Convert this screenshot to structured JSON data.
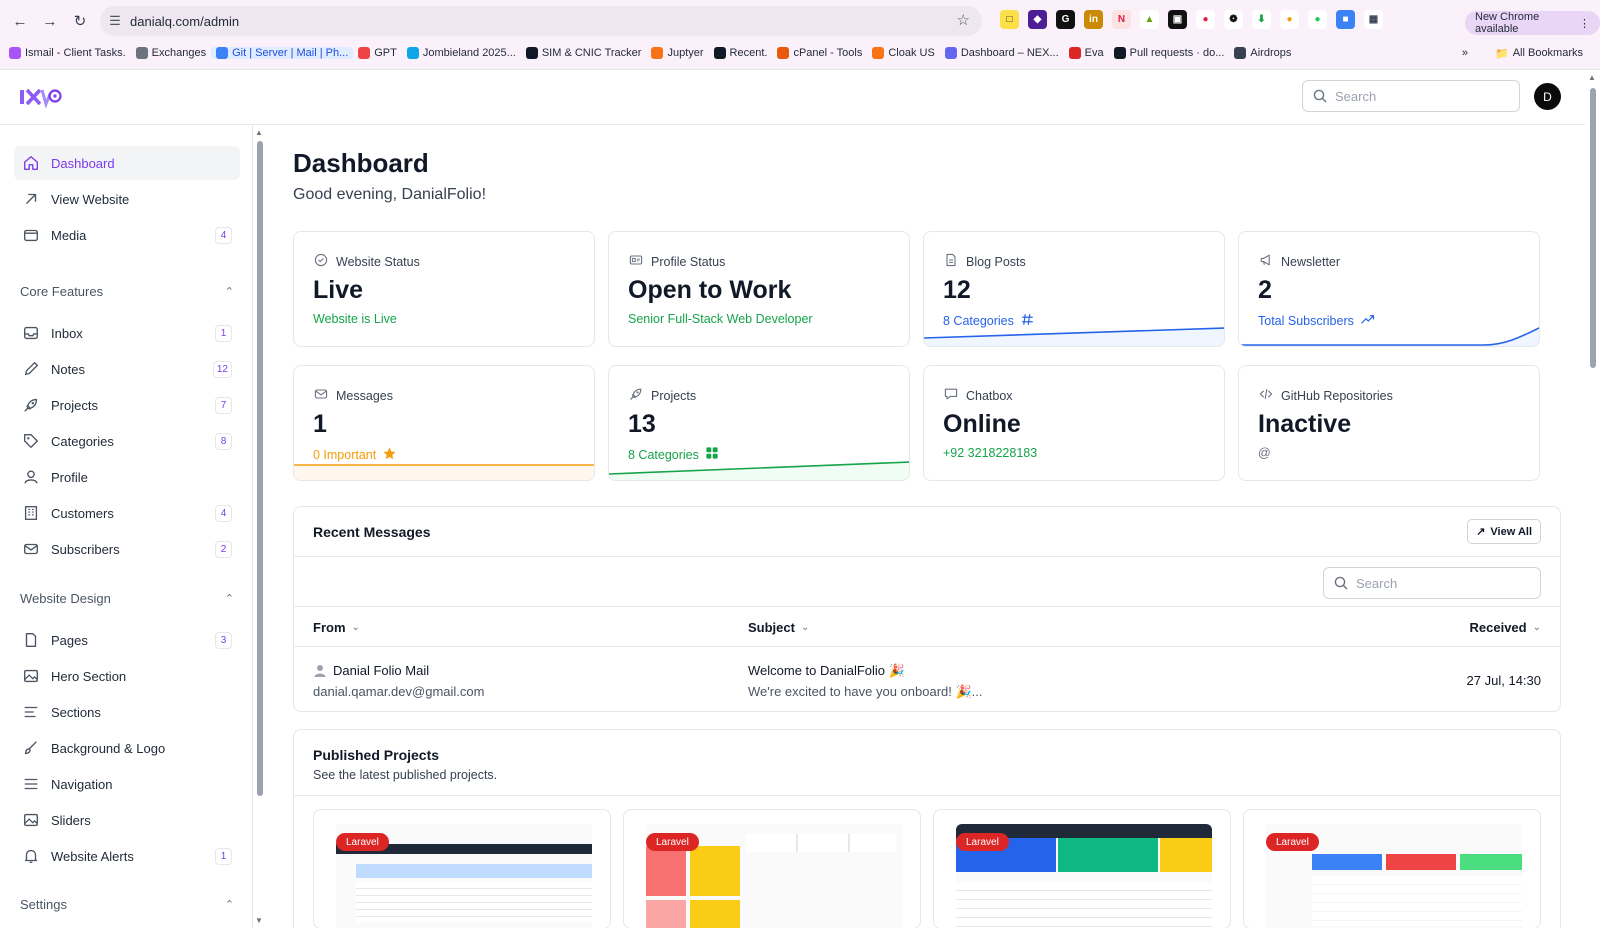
{
  "browser": {
    "url": "danialq.com/admin",
    "update_label": "New Chrome available",
    "bookmarks": [
      {
        "label": "Ismail - Client Tasks.",
        "color": "#a855f7"
      },
      {
        "label": "Exchanges",
        "color": "#6b7280"
      },
      {
        "label": "Git | Server | Mail | Ph...",
        "color": "#3b82f6"
      },
      {
        "label": "GPT",
        "color": "#ef4444"
      },
      {
        "label": "Jombieland 2025...",
        "color": "#0ea5e9"
      },
      {
        "label": "SIM & CNIC Tracker",
        "color": "#111827"
      },
      {
        "label": "Juptyer",
        "color": "#f97316"
      },
      {
        "label": "Recent.",
        "color": "#111827"
      },
      {
        "label": "cPanel - Tools",
        "color": "#ea580c"
      },
      {
        "label": "Cloak US",
        "color": "#f97316"
      },
      {
        "label": "Dashboard – NEX...",
        "color": "#6366f1"
      },
      {
        "label": "Eva",
        "color": "#dc2626"
      },
      {
        "label": "Pull requests · do...",
        "color": "#111827"
      },
      {
        "label": "Airdrops",
        "color": "#374151"
      }
    ],
    "all_bookmarks_label": "All Bookmarks"
  },
  "header": {
    "search_placeholder": "Search",
    "avatar_initial": "D"
  },
  "sidebar": {
    "top_items": [
      {
        "label": "Dashboard",
        "icon": "home-icon",
        "active": true
      },
      {
        "label": "View Website",
        "icon": "arrow-up-right-icon"
      },
      {
        "label": "Media",
        "icon": "folder-icon",
        "badge": "4"
      }
    ],
    "core_features": {
      "title": "Core Features",
      "items": [
        {
          "label": "Inbox",
          "icon": "inbox-icon",
          "badge": "1"
        },
        {
          "label": "Notes",
          "icon": "pencil-icon",
          "badge": "12"
        },
        {
          "label": "Projects",
          "icon": "rocket-icon",
          "badge": "7"
        },
        {
          "label": "Categories",
          "icon": "tag-icon",
          "badge": "8"
        },
        {
          "label": "Profile",
          "icon": "user-icon"
        },
        {
          "label": "Customers",
          "icon": "building-icon",
          "badge": "4"
        },
        {
          "label": "Subscribers",
          "icon": "mail-icon",
          "badge": "2"
        }
      ]
    },
    "website_design": {
      "title": "Website Design",
      "items": [
        {
          "label": "Pages",
          "icon": "page-icon",
          "badge": "3"
        },
        {
          "label": "Hero Section",
          "icon": "image-icon"
        },
        {
          "label": "Sections",
          "icon": "lines-icon"
        },
        {
          "label": "Background & Logo",
          "icon": "brush-icon"
        },
        {
          "label": "Navigation",
          "icon": "menu-icon"
        },
        {
          "label": "Sliders",
          "icon": "image-icon"
        },
        {
          "label": "Website Alerts",
          "icon": "bell-icon",
          "badge": "1"
        }
      ]
    },
    "settings_title": "Settings"
  },
  "main": {
    "title": "Dashboard",
    "greeting": "Good evening, DanialFolio!",
    "cards": [
      {
        "label": "Website Status",
        "value": "Live",
        "sub": "Website is Live",
        "sub_color": "#16a34a",
        "icon": "check-circle-icon"
      },
      {
        "label": "Profile Status",
        "value": "Open to Work",
        "sub": "Senior Full-Stack Web Developer",
        "sub_color": "#16a34a",
        "icon": "id-card-icon"
      },
      {
        "label": "Blog Posts",
        "value": "12",
        "sub": "8 Categories",
        "sub_color": "#2563eb",
        "icon": "document-icon",
        "sub_icon": "hash-icon"
      },
      {
        "label": "Newsletter",
        "value": "2",
        "sub": "Total Subscribers",
        "sub_color": "#2563eb",
        "icon": "megaphone-icon",
        "sub_icon": "trend-up-icon"
      },
      {
        "label": "Messages",
        "value": "1",
        "sub": "0 Important",
        "sub_color": "#f59e0b",
        "icon": "envelope-icon",
        "sub_icon": "star-icon"
      },
      {
        "label": "Projects",
        "value": "13",
        "sub": "8 Categories",
        "sub_color": "#16a34a",
        "icon": "rocket-icon",
        "sub_icon": "grid-icon"
      },
      {
        "label": "Chatbox",
        "value": "Online",
        "sub": "+92 3218228183",
        "sub_color": "#16a34a",
        "icon": "chat-icon"
      },
      {
        "label": "GitHub Repositories",
        "value": "Inactive",
        "sub": "@",
        "sub_color": "#6b7280",
        "icon": "code-icon"
      }
    ],
    "recent_messages": {
      "title": "Recent Messages",
      "view_all": "View All",
      "search_placeholder": "Search",
      "columns": [
        "From",
        "Subject",
        "Received"
      ],
      "rows": [
        {
          "from_name": "Danial Folio Mail",
          "from_email": "danial.qamar.dev@gmail.com",
          "subject": "Welcome to DanialFolio 🎉",
          "preview": "We're excited to have you onboard! 🎉...",
          "received": "27 Jul, 14:30"
        }
      ]
    },
    "published_projects": {
      "title": "Published Projects",
      "subtitle": "See the latest published projects.",
      "projects": [
        {
          "tag": "Laravel"
        },
        {
          "tag": "Laravel"
        },
        {
          "tag": "Laravel"
        },
        {
          "tag": "Laravel"
        }
      ]
    }
  }
}
